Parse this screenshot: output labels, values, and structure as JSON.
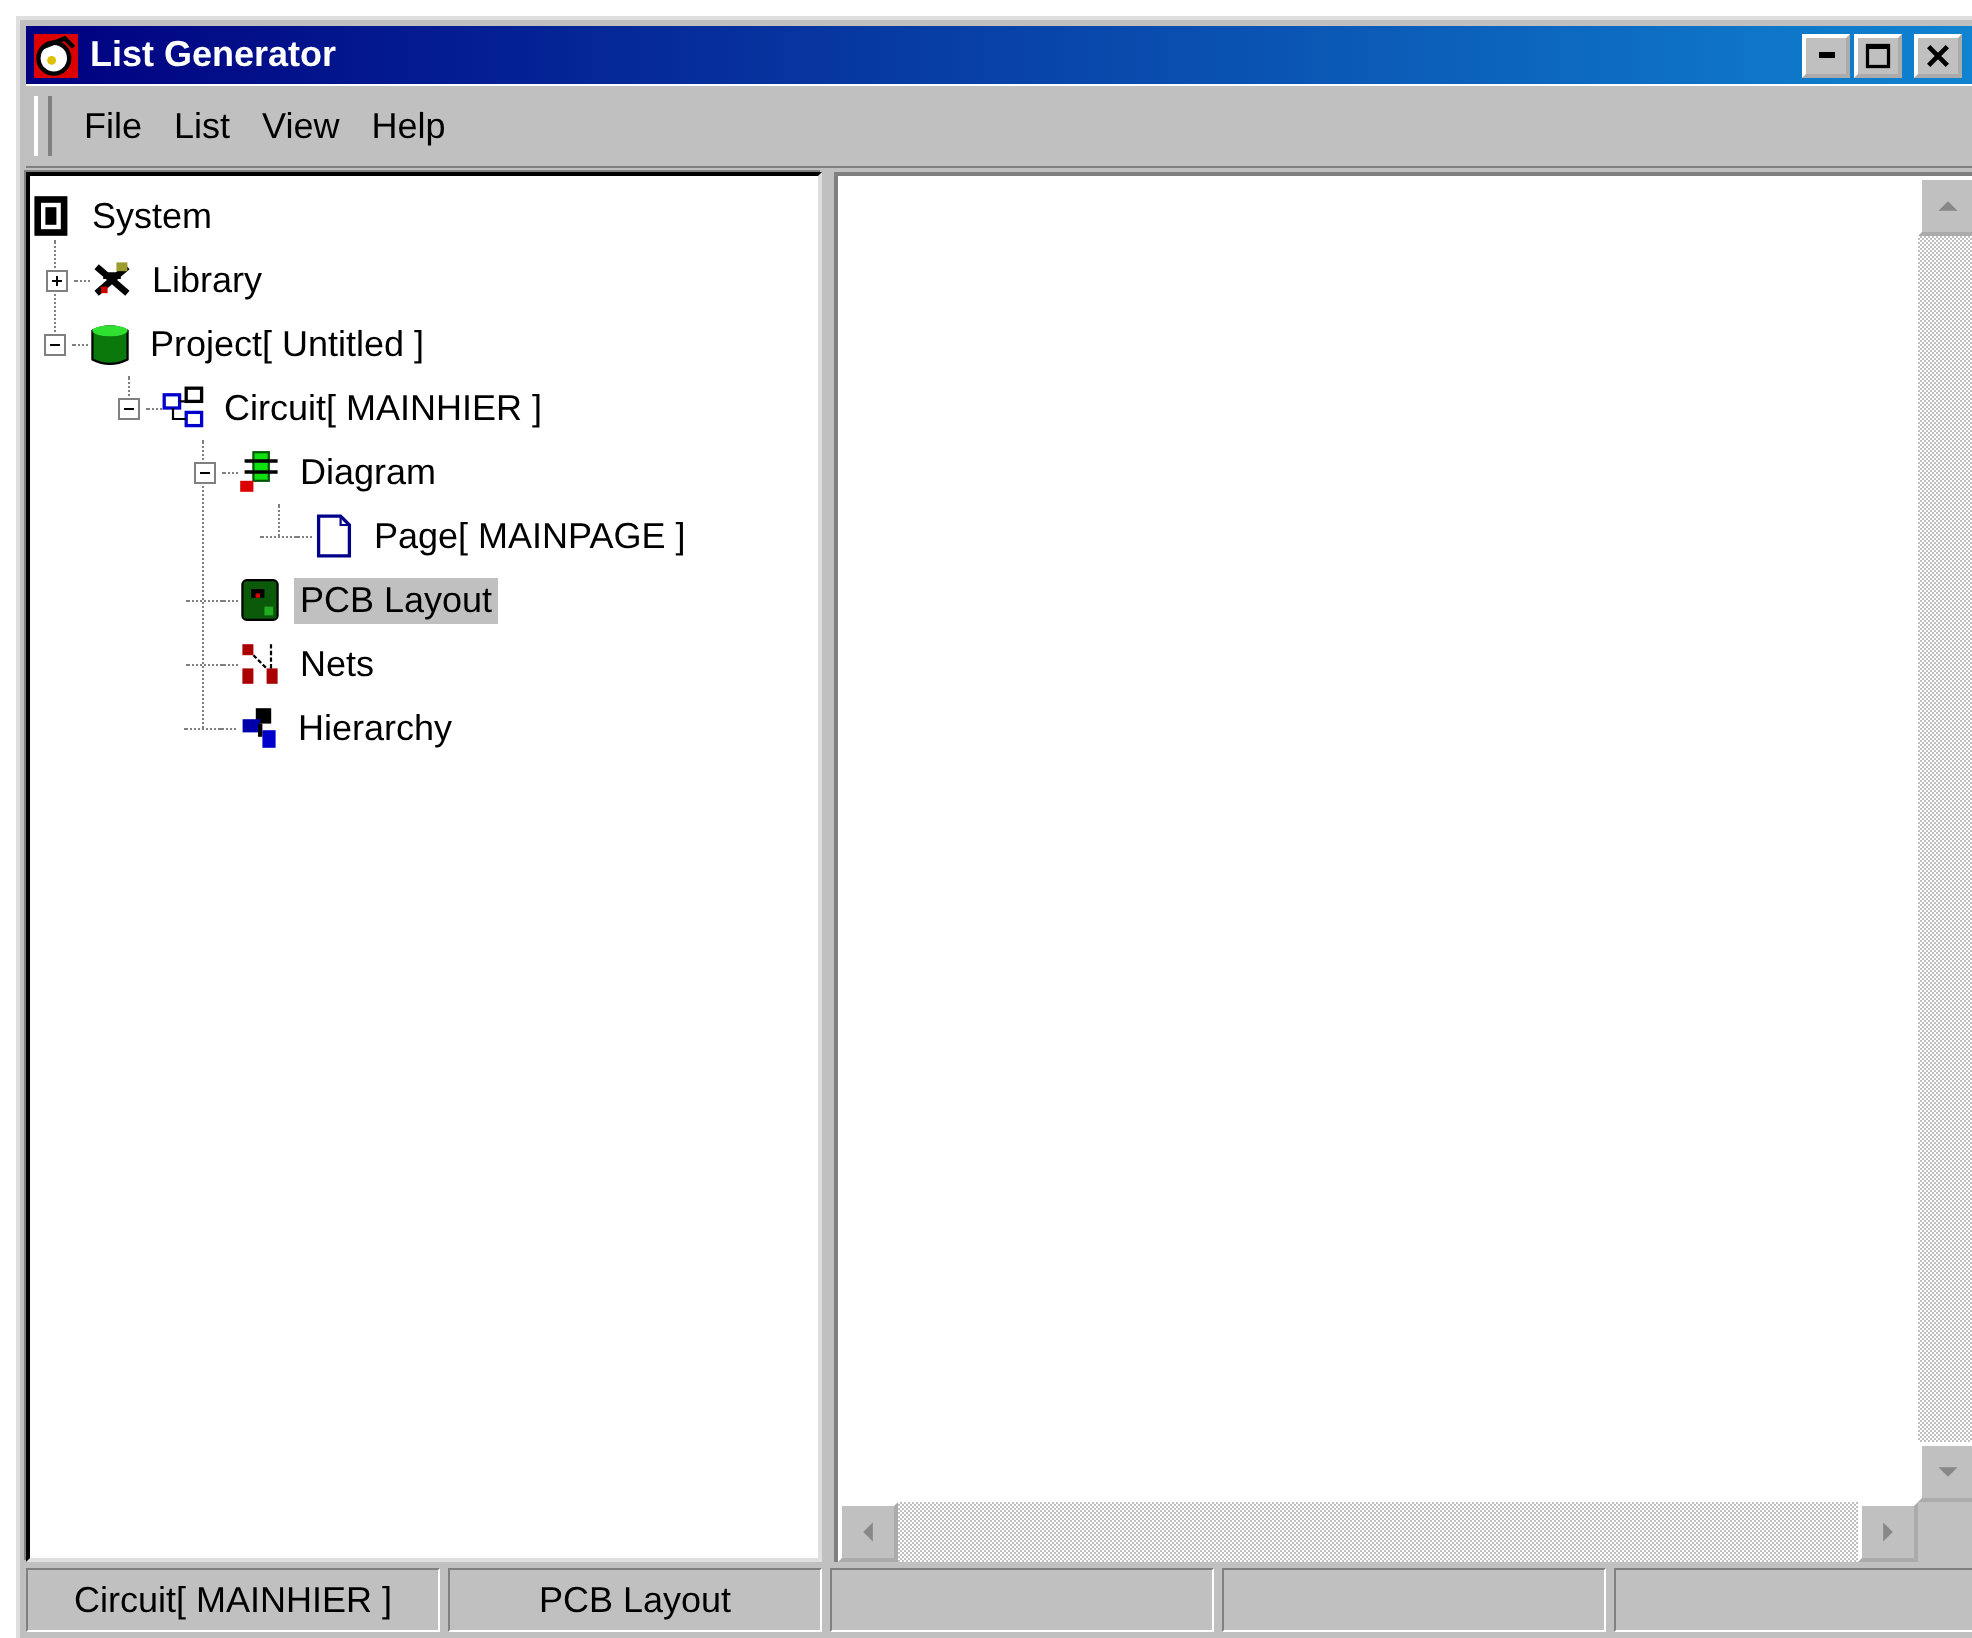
{
  "window": {
    "title": "List Generator"
  },
  "menu": [
    "File",
    "List",
    "View",
    "Help"
  ],
  "tree": [
    {
      "label": "System",
      "kind": "system",
      "selected": false,
      "children": [
        {
          "label": "Library",
          "kind": "library",
          "selected": false,
          "expanded": false
        },
        {
          "label": "Project[ Untitled ]",
          "kind": "project",
          "selected": false,
          "expanded": true,
          "children": [
            {
              "label": "Circuit[ MAINHIER ]",
              "kind": "circuit",
              "selected": false,
              "expanded": true,
              "children": [
                {
                  "label": "Diagram",
                  "kind": "diagram",
                  "selected": false,
                  "expanded": true,
                  "children": [
                    {
                      "label": "Page[ MAINPAGE ]",
                      "kind": "page",
                      "selected": false
                    }
                  ]
                },
                {
                  "label": "PCB Layout",
                  "kind": "pcb",
                  "selected": true
                },
                {
                  "label": "Nets",
                  "kind": "nets",
                  "selected": false
                },
                {
                  "label": "Hierarchy",
                  "kind": "hierarchy",
                  "selected": false
                }
              ]
            }
          ]
        }
      ]
    }
  ],
  "status_bar": [
    "Circuit[ MAINHIER ]",
    "PCB Layout"
  ]
}
